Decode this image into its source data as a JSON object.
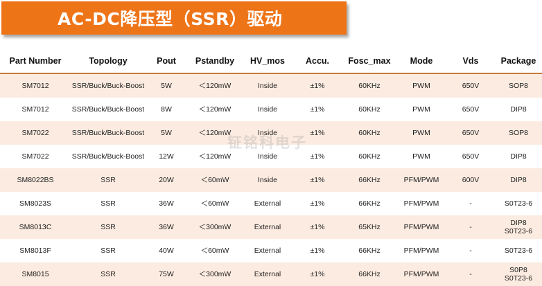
{
  "banner": {
    "title": "AC-DC降压型（SSR）驱动",
    "color": "#ee7418"
  },
  "table": {
    "headers": [
      "Part Number",
      "Topology",
      "Pout",
      "Pstandby",
      "HV_mos",
      "Accu.",
      "Fosc_max",
      "Mode",
      "Vds",
      "Package"
    ],
    "rows": [
      {
        "part": "SM7012",
        "topology": "SSR/Buck/Buck-Boost",
        "pout": "5W",
        "pstandby": "＜120mW",
        "hv_mos": "Inside",
        "accu": "±1%",
        "fosc": "60KHz",
        "mode": "PWM",
        "vds": "650V",
        "package": [
          "SOP8"
        ]
      },
      {
        "part": "SM7012",
        "topology": "SSR/Buck/Buck-Boost",
        "pout": "8W",
        "pstandby": "＜120mW",
        "hv_mos": "Inside",
        "accu": "±1%",
        "fosc": "60KHz",
        "mode": "PWM",
        "vds": "650V",
        "package": [
          "DIP8"
        ]
      },
      {
        "part": "SM7022",
        "topology": "SSR/Buck/Buck-Boost",
        "pout": "5W",
        "pstandby": "＜120mW",
        "hv_mos": "Inside",
        "accu": "±1%",
        "fosc": "60KHz",
        "mode": "PWM",
        "vds": "650V",
        "package": [
          "SOP8"
        ]
      },
      {
        "part": "SM7022",
        "topology": "SSR/Buck/Buck-Boost",
        "pout": "12W",
        "pstandby": "＜120mW",
        "hv_mos": "Inside",
        "accu": "±1%",
        "fosc": "60KHz",
        "mode": "PWM",
        "vds": "650V",
        "package": [
          "DIP8"
        ]
      },
      {
        "part": "SM8022BS",
        "topology": "SSR",
        "pout": "20W",
        "pstandby": "＜60mW",
        "hv_mos": "Inside",
        "accu": "±1%",
        "fosc": "66KHz",
        "mode": "PFM/PWM",
        "vds": "600V",
        "package": [
          "DIP8"
        ]
      },
      {
        "part": "SM8023S",
        "topology": "SSR",
        "pout": "36W",
        "pstandby": "＜60mW",
        "hv_mos": "External",
        "accu": "±1%",
        "fosc": "66KHz",
        "mode": "PFM/PWM",
        "vds": "-",
        "package": [
          "S0T23-6"
        ]
      },
      {
        "part": "SM8013C",
        "topology": "SSR",
        "pout": "36W",
        "pstandby": "＜300mW",
        "hv_mos": "External",
        "accu": "±1%",
        "fosc": "65KHz",
        "mode": "PFM/PWM",
        "vds": "-",
        "package": [
          "DIP8",
          "S0T23-6"
        ]
      },
      {
        "part": "SM8013F",
        "topology": "SSR",
        "pout": "40W",
        "pstandby": "＜60mW",
        "hv_mos": "External",
        "accu": "±1%",
        "fosc": "66KHz",
        "mode": "PFM/PWM",
        "vds": "-",
        "package": [
          "S0T23-6"
        ]
      },
      {
        "part": "SM8015",
        "topology": "SSR",
        "pout": "75W",
        "pstandby": "＜300mW",
        "hv_mos": "External",
        "accu": "±1%",
        "fosc": "66KHz",
        "mode": "PFM/PWM",
        "vds": "-",
        "package": [
          "S0P8",
          "S0T23-6"
        ]
      }
    ],
    "stripe_color": "#fcebe0"
  },
  "watermark": {
    "text": "钲铭科电子"
  }
}
